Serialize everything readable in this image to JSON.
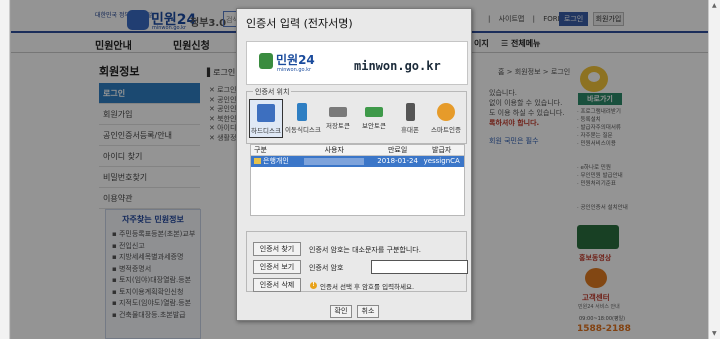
{
  "site": {
    "logo_small": "대한민국 정부민원포털",
    "logo_text": "민원24",
    "logo_sub": "minwon.go.kr",
    "gov30": "정부3.0",
    "search_placeholder": "검색어를 입력",
    "toplinks": [
      "|",
      "사이트맵",
      "|",
      "FOREIGNER"
    ],
    "login_label": "로그인",
    "join_label": "회원가입"
  },
  "nav": {
    "items": [
      "민원안내",
      "민원신청"
    ],
    "all_menu": "전체메뉴",
    "hidden_item": "이지"
  },
  "sidebar": {
    "title": "회원정보",
    "items": [
      {
        "label": "로그인",
        "active": true
      },
      {
        "label": "회원가입",
        "active": false
      },
      {
        "label": "공인인증서등록/안내",
        "active": false
      },
      {
        "label": "아이디 찾기",
        "active": false
      },
      {
        "label": "비밀번호찾기",
        "active": false
      },
      {
        "label": "이용약관",
        "active": false
      }
    ],
    "fav_title": "자주찾는 민원정보",
    "fav_items": [
      "주민등록표등본(초본)교부",
      "전입신고",
      "지방세세목별과세증명",
      "병적증명서",
      "토지(임야)대장열람.등본",
      "토지이용계획확인신청",
      "지적도(임야도)열람.등본",
      "건축물대장등.초본발급"
    ]
  },
  "content": {
    "title": "로그인",
    "breadcrumb": "홈 > 회원정보 > 로그인",
    "list": [
      "로그인하시",
      "공인인증서",
      "공인인증서",
      "북한인증서",
      "아이디로",
      "생활정보"
    ],
    "right_lines": [
      "있습니다.",
      "없이 이용할 수 있습니다.",
      "도 이용 하실 수 있습니다.",
      "록하셔야 합니다."
    ],
    "right_red": "록하셔야 합니다.",
    "right_blue": "회원 국민은 필수"
  },
  "right_sidebar": {
    "quick_label": "바로가기",
    "quick_items": [
      "· 프로그램내려받기",
      "· 등록설치",
      "· 발급자주의대서류",
      "· 자주묻는 질문",
      "· 민원서비스이용"
    ],
    "other_items": [
      "· e하나로 민원",
      "· 무인민원 발급안내",
      "· 민원처리기준표"
    ],
    "other_items2": [
      "· 공인인증서 설치안내"
    ],
    "video_label": "홍보동영상",
    "call_title": "고객센터",
    "call_sub": "민원24 서비스 안내",
    "call_hours": "09:00~18:00(평일)",
    "call_number": "1588-2188"
  },
  "dialog": {
    "title": "인증서 입력 (전자서명)",
    "banner": {
      "logo": "민원24",
      "logo_sub": "minwon.go.kr",
      "url": "minwon.go.kr"
    },
    "location_legend": "인증서 위치",
    "locations": [
      {
        "label": "하드디스크",
        "icon": "hard-disk-icon",
        "color": "#3d6fbf",
        "selected": true
      },
      {
        "label": "이동식디스크",
        "icon": "usb-drive-icon",
        "color": "#2f7fc3",
        "selected": false
      },
      {
        "label": "저장토큰",
        "icon": "token-icon",
        "color": "#7a7a7a",
        "selected": false
      },
      {
        "label": "보안토큰",
        "icon": "security-token-icon",
        "color": "#3f9a4a",
        "selected": false
      },
      {
        "label": "휴대폰",
        "icon": "mobile-phone-icon",
        "color": "#555555",
        "selected": false
      },
      {
        "label": "스마트인증",
        "icon": "smart-auth-icon",
        "color": "#e69b2a",
        "selected": false
      }
    ],
    "table": {
      "headers": [
        "구분",
        "사용자",
        "만료일",
        "발급자"
      ],
      "rows": [
        {
          "type": "은행개인",
          "user": "",
          "expiry": "2018-01-24",
          "issuer": "yessignCA"
        }
      ]
    },
    "actions": {
      "find_label": "인증서 찾기",
      "view_label": "인증서 보기",
      "delete_label": "인증서 삭제",
      "info_text": "인증서 암호는 대소문자를 구분합니다.",
      "pwd_label": "인증서 암호",
      "pwd_value": "",
      "warning_text": "인증서 선택 후 암호를 입력하세요."
    },
    "ok_label": "확인",
    "cancel_label": "취소"
  }
}
